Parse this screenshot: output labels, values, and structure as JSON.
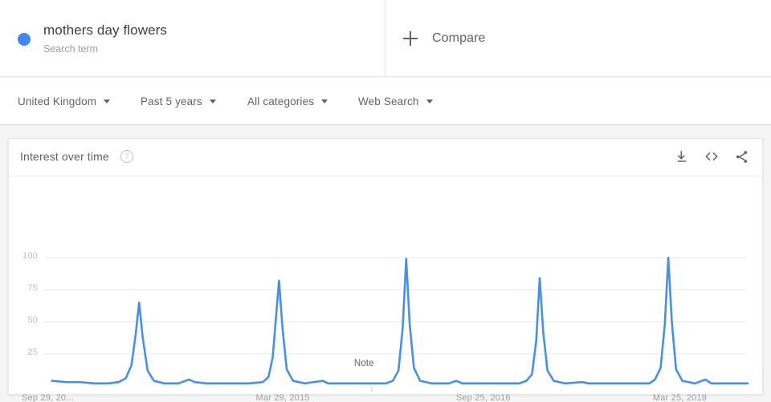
{
  "search_term": {
    "dot_color": "#4285f4",
    "title": "mothers day flowers",
    "subtitle": "Search term"
  },
  "compare": {
    "label": "Compare",
    "icon": "plus-icon"
  },
  "filters": [
    {
      "label": "United Kingdom",
      "icon": "chevron-down-icon"
    },
    {
      "label": "Past 5 years",
      "icon": "chevron-down-icon"
    },
    {
      "label": "All categories",
      "icon": "chevron-down-icon"
    },
    {
      "label": "Web Search",
      "icon": "chevron-down-icon"
    }
  ],
  "card": {
    "title": "Interest over time",
    "help_icon": "?",
    "help_icon_name": "help-circle-icon",
    "actions": [
      {
        "name": "download-icon",
        "tooltip": "Download"
      },
      {
        "name": "embed-code-icon",
        "tooltip": "Embed"
      },
      {
        "name": "share-icon",
        "tooltip": "Share"
      }
    ]
  },
  "chart_data": {
    "type": "line",
    "title": "Interest over time",
    "xlabel": "",
    "ylabel": "",
    "ylim": [
      0,
      100
    ],
    "yticks": [
      25,
      50,
      75,
      100
    ],
    "grid": true,
    "legend": "none",
    "line_color": "#4a90e2",
    "xtick_labels": [
      "Sep 29, 20...",
      "Mar 29, 2015",
      "Sep 25, 2016",
      "Mar 25, 2018"
    ],
    "xtick_positions_pct": [
      3.0,
      34.0,
      62.5,
      90.5
    ],
    "annotations": [
      {
        "text": "Note",
        "x_pct": 46.5,
        "y_value": 6
      }
    ],
    "series": [
      {
        "name": "mothers day flowers",
        "points": [
          {
            "x_pct": 1.0,
            "y": 4
          },
          {
            "x_pct": 3.0,
            "y": 3
          },
          {
            "x_pct": 5.0,
            "y": 3
          },
          {
            "x_pct": 7.0,
            "y": 2
          },
          {
            "x_pct": 9.0,
            "y": 2
          },
          {
            "x_pct": 10.5,
            "y": 3
          },
          {
            "x_pct": 11.5,
            "y": 6
          },
          {
            "x_pct": 12.3,
            "y": 16
          },
          {
            "x_pct": 12.9,
            "y": 40
          },
          {
            "x_pct": 13.4,
            "y": 65
          },
          {
            "x_pct": 13.9,
            "y": 38
          },
          {
            "x_pct": 14.6,
            "y": 12
          },
          {
            "x_pct": 15.5,
            "y": 4
          },
          {
            "x_pct": 17.0,
            "y": 2
          },
          {
            "x_pct": 19.0,
            "y": 2
          },
          {
            "x_pct": 20.5,
            "y": 5
          },
          {
            "x_pct": 21.3,
            "y": 3
          },
          {
            "x_pct": 23.0,
            "y": 2
          },
          {
            "x_pct": 26.0,
            "y": 2
          },
          {
            "x_pct": 29.0,
            "y": 2
          },
          {
            "x_pct": 31.0,
            "y": 3
          },
          {
            "x_pct": 31.8,
            "y": 7
          },
          {
            "x_pct": 32.4,
            "y": 22
          },
          {
            "x_pct": 32.9,
            "y": 55
          },
          {
            "x_pct": 33.3,
            "y": 82
          },
          {
            "x_pct": 33.8,
            "y": 45
          },
          {
            "x_pct": 34.4,
            "y": 13
          },
          {
            "x_pct": 35.3,
            "y": 4
          },
          {
            "x_pct": 37.0,
            "y": 2
          },
          {
            "x_pct": 39.5,
            "y": 4
          },
          {
            "x_pct": 40.3,
            "y": 2
          },
          {
            "x_pct": 43.0,
            "y": 2
          },
          {
            "x_pct": 46.0,
            "y": 2
          },
          {
            "x_pct": 48.5,
            "y": 2
          },
          {
            "x_pct": 49.5,
            "y": 4
          },
          {
            "x_pct": 50.3,
            "y": 12
          },
          {
            "x_pct": 50.9,
            "y": 45
          },
          {
            "x_pct": 51.4,
            "y": 99
          },
          {
            "x_pct": 51.9,
            "y": 48
          },
          {
            "x_pct": 52.5,
            "y": 14
          },
          {
            "x_pct": 53.4,
            "y": 4
          },
          {
            "x_pct": 55.0,
            "y": 2
          },
          {
            "x_pct": 57.5,
            "y": 2
          },
          {
            "x_pct": 58.5,
            "y": 4
          },
          {
            "x_pct": 59.4,
            "y": 2
          },
          {
            "x_pct": 62.0,
            "y": 2
          },
          {
            "x_pct": 65.0,
            "y": 2
          },
          {
            "x_pct": 67.5,
            "y": 2
          },
          {
            "x_pct": 68.5,
            "y": 4
          },
          {
            "x_pct": 69.3,
            "y": 9
          },
          {
            "x_pct": 69.9,
            "y": 35
          },
          {
            "x_pct": 70.4,
            "y": 84
          },
          {
            "x_pct": 70.9,
            "y": 42
          },
          {
            "x_pct": 71.5,
            "y": 12
          },
          {
            "x_pct": 72.4,
            "y": 4
          },
          {
            "x_pct": 74.0,
            "y": 2
          },
          {
            "x_pct": 76.5,
            "y": 3
          },
          {
            "x_pct": 77.3,
            "y": 2
          },
          {
            "x_pct": 80.0,
            "y": 2
          },
          {
            "x_pct": 83.0,
            "y": 2
          },
          {
            "x_pct": 86.0,
            "y": 2
          },
          {
            "x_pct": 86.8,
            "y": 5
          },
          {
            "x_pct": 87.6,
            "y": 14
          },
          {
            "x_pct": 88.2,
            "y": 48
          },
          {
            "x_pct": 88.7,
            "y": 100
          },
          {
            "x_pct": 89.2,
            "y": 50
          },
          {
            "x_pct": 89.8,
            "y": 13
          },
          {
            "x_pct": 90.7,
            "y": 4
          },
          {
            "x_pct": 92.5,
            "y": 2
          },
          {
            "x_pct": 94.0,
            "y": 5
          },
          {
            "x_pct": 94.8,
            "y": 2
          },
          {
            "x_pct": 97.0,
            "y": 2
          },
          {
            "x_pct": 99.5,
            "y": 2
          },
          {
            "x_pct": 100,
            "y": 2
          }
        ]
      }
    ]
  }
}
